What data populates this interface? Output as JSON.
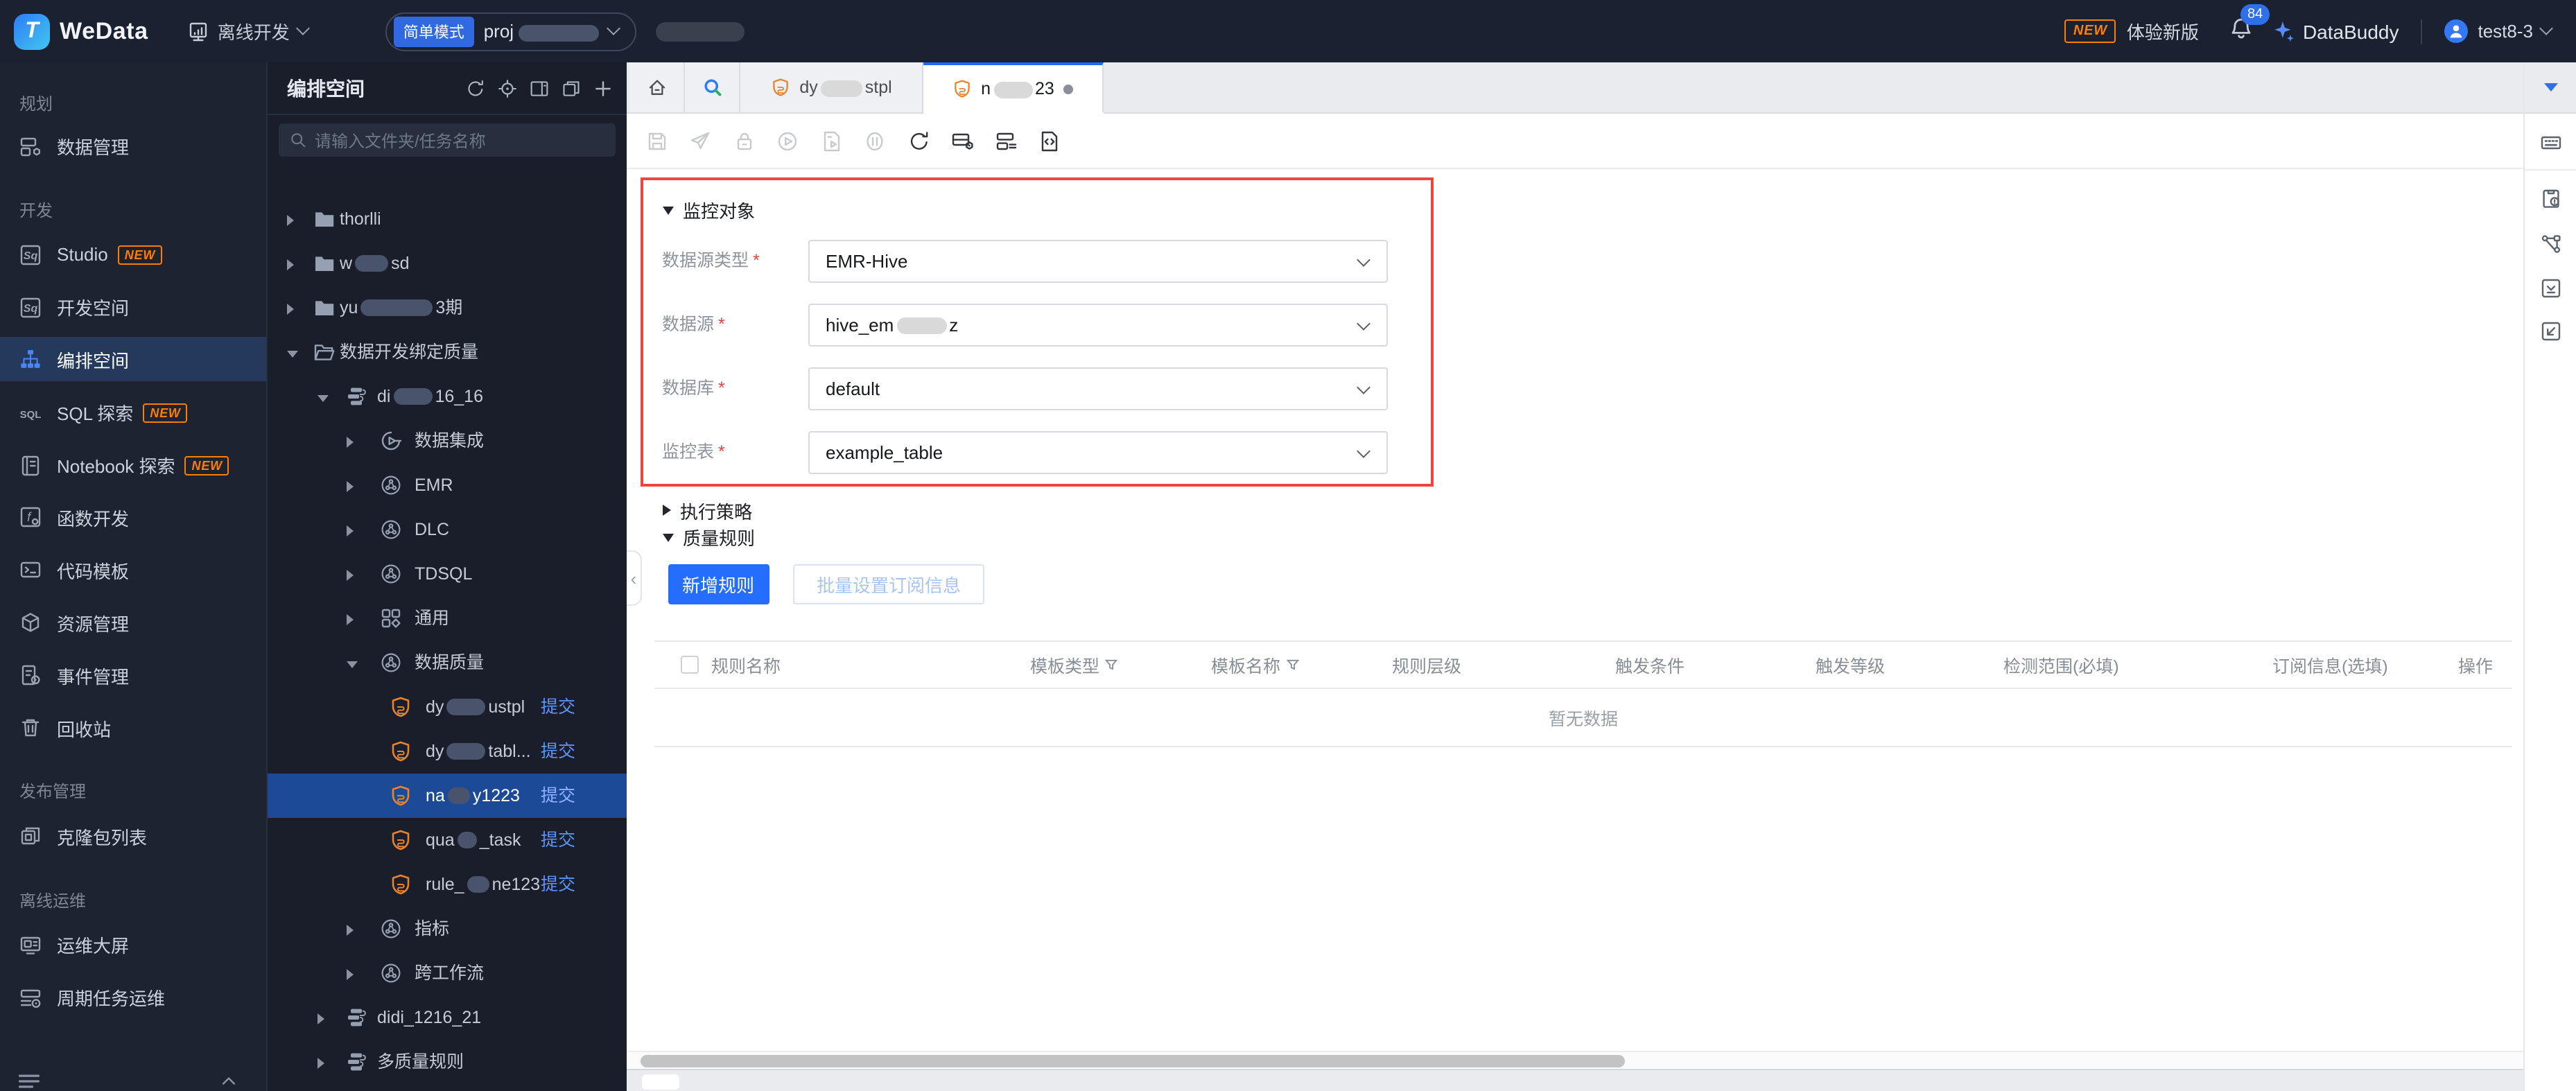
{
  "topbar": {
    "logo": "WeData",
    "nav_label": "离线开发",
    "mode_badge": "简单模式",
    "project_prefix": "proj",
    "new_badge": "NEW",
    "try_new_label": "体验新版",
    "notification_count": "84",
    "assistant_label": "DataBuddy",
    "user_name": "test8-3"
  },
  "sidebar": {
    "sections": [
      {
        "label": "规划",
        "items": [
          {
            "icon": "data-mgmt",
            "label": "数据管理"
          }
        ]
      },
      {
        "label": "开发",
        "items": [
          {
            "icon": "studio",
            "label": "Studio",
            "badge": "NEW"
          },
          {
            "icon": "dev-space",
            "label": "开发空间"
          },
          {
            "icon": "orchestrate",
            "label": "编排空间",
            "active": true
          },
          {
            "icon": "sql",
            "label": "SQL 探索",
            "badge": "NEW"
          },
          {
            "icon": "notebook",
            "label": "Notebook 探索",
            "badge": "NEW"
          },
          {
            "icon": "fx",
            "label": "函数开发"
          },
          {
            "icon": "code-template",
            "label": "代码模板"
          },
          {
            "icon": "resource",
            "label": "资源管理"
          },
          {
            "icon": "event",
            "label": "事件管理"
          },
          {
            "icon": "trash",
            "label": "回收站"
          }
        ]
      },
      {
        "label": "发布管理",
        "items": [
          {
            "icon": "clone",
            "label": "克隆包列表"
          }
        ]
      },
      {
        "label": "离线运维",
        "items": [
          {
            "icon": "screen",
            "label": "运维大屏"
          },
          {
            "icon": "cycle",
            "label": "周期任务运维"
          }
        ]
      }
    ]
  },
  "tree": {
    "title": "编排空间",
    "header_icons": [
      "refresh",
      "locate",
      "panel",
      "copy",
      "plus"
    ],
    "search_placeholder": "请输入文件夹/任务名称",
    "items": [
      {
        "depth": 1,
        "caret": "right",
        "icon": "folder",
        "pre": "thorlli"
      },
      {
        "depth": 1,
        "caret": "right",
        "icon": "folder",
        "pre": "w",
        "redact": 24,
        "post": "sd"
      },
      {
        "depth": 1,
        "caret": "right",
        "icon": "folder",
        "pre": "yu",
        "redact": 52,
        "post": "3期"
      },
      {
        "depth": 1,
        "caret": "down",
        "icon": "folder-open",
        "pre": "数据开发绑定质量"
      },
      {
        "depth": 2,
        "caret": "down",
        "icon": "workflow",
        "pre": "di",
        "redact": 28,
        "post": "16_16"
      },
      {
        "depth": 3,
        "caret": "right",
        "icon": "integration",
        "pre": "数据集成"
      },
      {
        "depth": 3,
        "caret": "right",
        "icon": "hex",
        "pre": "EMR"
      },
      {
        "depth": 3,
        "caret": "right",
        "icon": "hex",
        "pre": "DLC"
      },
      {
        "depth": 3,
        "caret": "right",
        "icon": "hex",
        "pre": "TDSQL"
      },
      {
        "depth": 3,
        "caret": "right",
        "icon": "squares",
        "pre": "通用"
      },
      {
        "depth": 3,
        "caret": "down",
        "icon": "hex",
        "pre": "数据质量"
      },
      {
        "depth": 4,
        "icon": "shield",
        "pre": "dy",
        "redact": 28,
        "post": "ustpl",
        "action": "提交"
      },
      {
        "depth": 4,
        "icon": "shield",
        "pre": "dy",
        "redact": 28,
        "post": "tabl...",
        "action": "提交"
      },
      {
        "depth": 4,
        "icon": "shield",
        "pre": "na",
        "redact": 16,
        "post": "y1223",
        "action": "提交",
        "selected": true
      },
      {
        "depth": 4,
        "icon": "shield",
        "pre": "qua",
        "redact": 14,
        "post": "_task",
        "action": "提交"
      },
      {
        "depth": 4,
        "icon": "shield",
        "pre": "rule_",
        "redact": 16,
        "post": "ne123",
        "action": "提交"
      },
      {
        "depth": 3,
        "caret": "right",
        "icon": "hex",
        "pre": "指标"
      },
      {
        "depth": 3,
        "caret": "right",
        "icon": "hex",
        "pre": "跨工作流"
      },
      {
        "depth": 2,
        "caret": "right",
        "icon": "workflow",
        "pre": "didi_1216_21"
      },
      {
        "depth": 2,
        "caret": "right",
        "icon": "workflow",
        "pre": "多质量规则"
      }
    ]
  },
  "tabs": {
    "items": [
      {
        "icon": "home"
      },
      {
        "icon": "search-colorful"
      },
      {
        "icon": "shield",
        "pre": "dy",
        "redact": 30,
        "post": "stpl"
      },
      {
        "icon": "shield",
        "pre": "n",
        "redact": 28,
        "post": "23",
        "active": true,
        "dirty": true
      }
    ]
  },
  "toolbar": {
    "items": [
      {
        "name": "save",
        "enabled": false
      },
      {
        "name": "send",
        "enabled": false
      },
      {
        "name": "lock",
        "enabled": false
      },
      {
        "name": "play",
        "enabled": false
      },
      {
        "name": "file-run",
        "enabled": false
      },
      {
        "name": "pause",
        "enabled": false
      },
      {
        "name": "refresh",
        "enabled": true
      },
      {
        "name": "rule-config",
        "enabled": true
      },
      {
        "name": "rule-list",
        "enabled": true
      },
      {
        "name": "code",
        "enabled": true
      }
    ]
  },
  "rail": {
    "items": [
      "keyboard",
      "clipboard",
      "flow",
      "download",
      "resize"
    ]
  },
  "form": {
    "monitor_section": "监控对象",
    "strategy_section": "执行策略",
    "rules_section": "质量规则",
    "fields": [
      {
        "label": "数据源类型",
        "required": true,
        "value": "EMR-Hive"
      },
      {
        "label": "数据源",
        "required": true,
        "value_pre": "hive_em",
        "redact": 36,
        "value_post": "z"
      },
      {
        "label": "数据库",
        "required": true,
        "value": "default"
      },
      {
        "label": "监控表",
        "required": true,
        "value": "example_table"
      }
    ],
    "add_rule_label": "新增规则",
    "batch_subscribe_label": "批量设置订阅信息"
  },
  "rules_table": {
    "columns": [
      {
        "label": "规则名称"
      },
      {
        "label": "模板类型",
        "filter": true
      },
      {
        "label": "模板名称",
        "filter": true
      },
      {
        "label": "规则层级"
      },
      {
        "label": "触发条件"
      },
      {
        "label": "触发等级"
      },
      {
        "label": "检测范围(必填)"
      },
      {
        "label": "订阅信息(选填)"
      },
      {
        "label": "操作"
      }
    ],
    "empty_text": "暂无数据"
  },
  "colors": {
    "accent_blue": "#256dfd",
    "annotation_red": "#f0453d",
    "selected_tree_blue": "#1d4a97",
    "badge_orange": "#ff7d00",
    "shield_orange": "#e8832c"
  }
}
